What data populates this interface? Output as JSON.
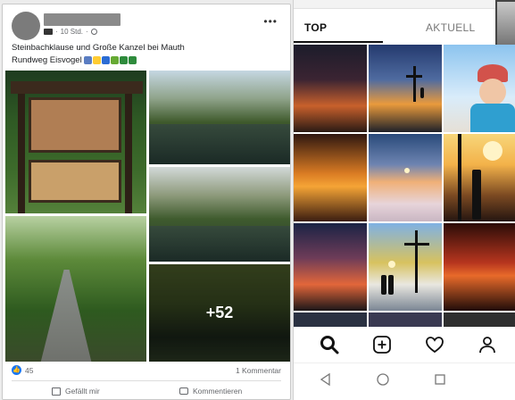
{
  "facebook_post": {
    "timestamp": "10 Std.",
    "text_line1": "Steinbachklause und Große Kanzel bei Mauth",
    "text_line2": "Rundweg Eisvogel",
    "more_photos_label": "+52",
    "like_count": "45",
    "comment_count": "1 Kommentar",
    "like_button_label": "Gefällt mir",
    "comment_button_label": "Kommentieren",
    "emoji_colors": [
      "#5a7dc2",
      "#ffcc33",
      "#2b6cd4",
      "#66aa33",
      "#2e8b3c",
      "#2e8b3c"
    ]
  },
  "instagram": {
    "tabs": [
      {
        "label": "TOP",
        "active": true
      },
      {
        "label": "AKTUELL",
        "active": false
      }
    ],
    "nav_icons": [
      "search-icon",
      "add-post-icon",
      "heart-icon",
      "profile-icon"
    ],
    "android_nav_icons": [
      "back-icon",
      "home-icon",
      "recent-apps-icon"
    ]
  },
  "colors": {
    "facebook_blue": "#1877f2",
    "muted_text": "#65676b"
  }
}
